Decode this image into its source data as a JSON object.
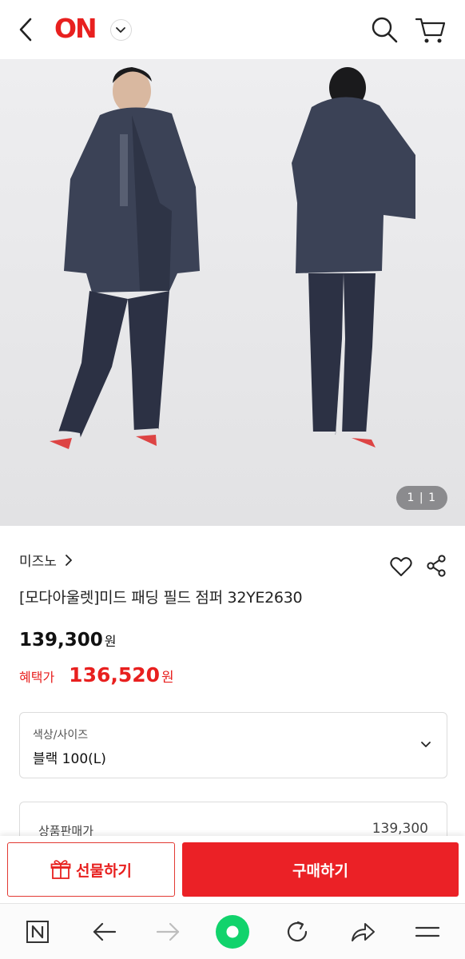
{
  "header": {
    "logo_text": "ON",
    "logo_color": "#e8201f"
  },
  "gallery": {
    "counter_current": "1",
    "counter_total": "1"
  },
  "product": {
    "brand": "미즈노",
    "title": "[모다아울렛]미드 패딩 필드 점퍼 32YE2630",
    "price": "139,300",
    "price_unit": "원",
    "benefit_label": "혜택가",
    "benefit_price": "136,520",
    "benefit_unit": "원",
    "accent_color": "#e8201f"
  },
  "option": {
    "label": "색상/사이즈",
    "value": "블랙 100(L)"
  },
  "summary": {
    "label": "상품판매가",
    "value": "139,300"
  },
  "actions": {
    "gift_label": "선물하기",
    "buy_label": "구매하기"
  },
  "browser_nav": {
    "icons": [
      "naver-n-icon",
      "back-arrow-icon",
      "forward-arrow-icon",
      "green-dot-icon",
      "refresh-icon",
      "share-forward-icon",
      "menu-icon"
    ]
  }
}
